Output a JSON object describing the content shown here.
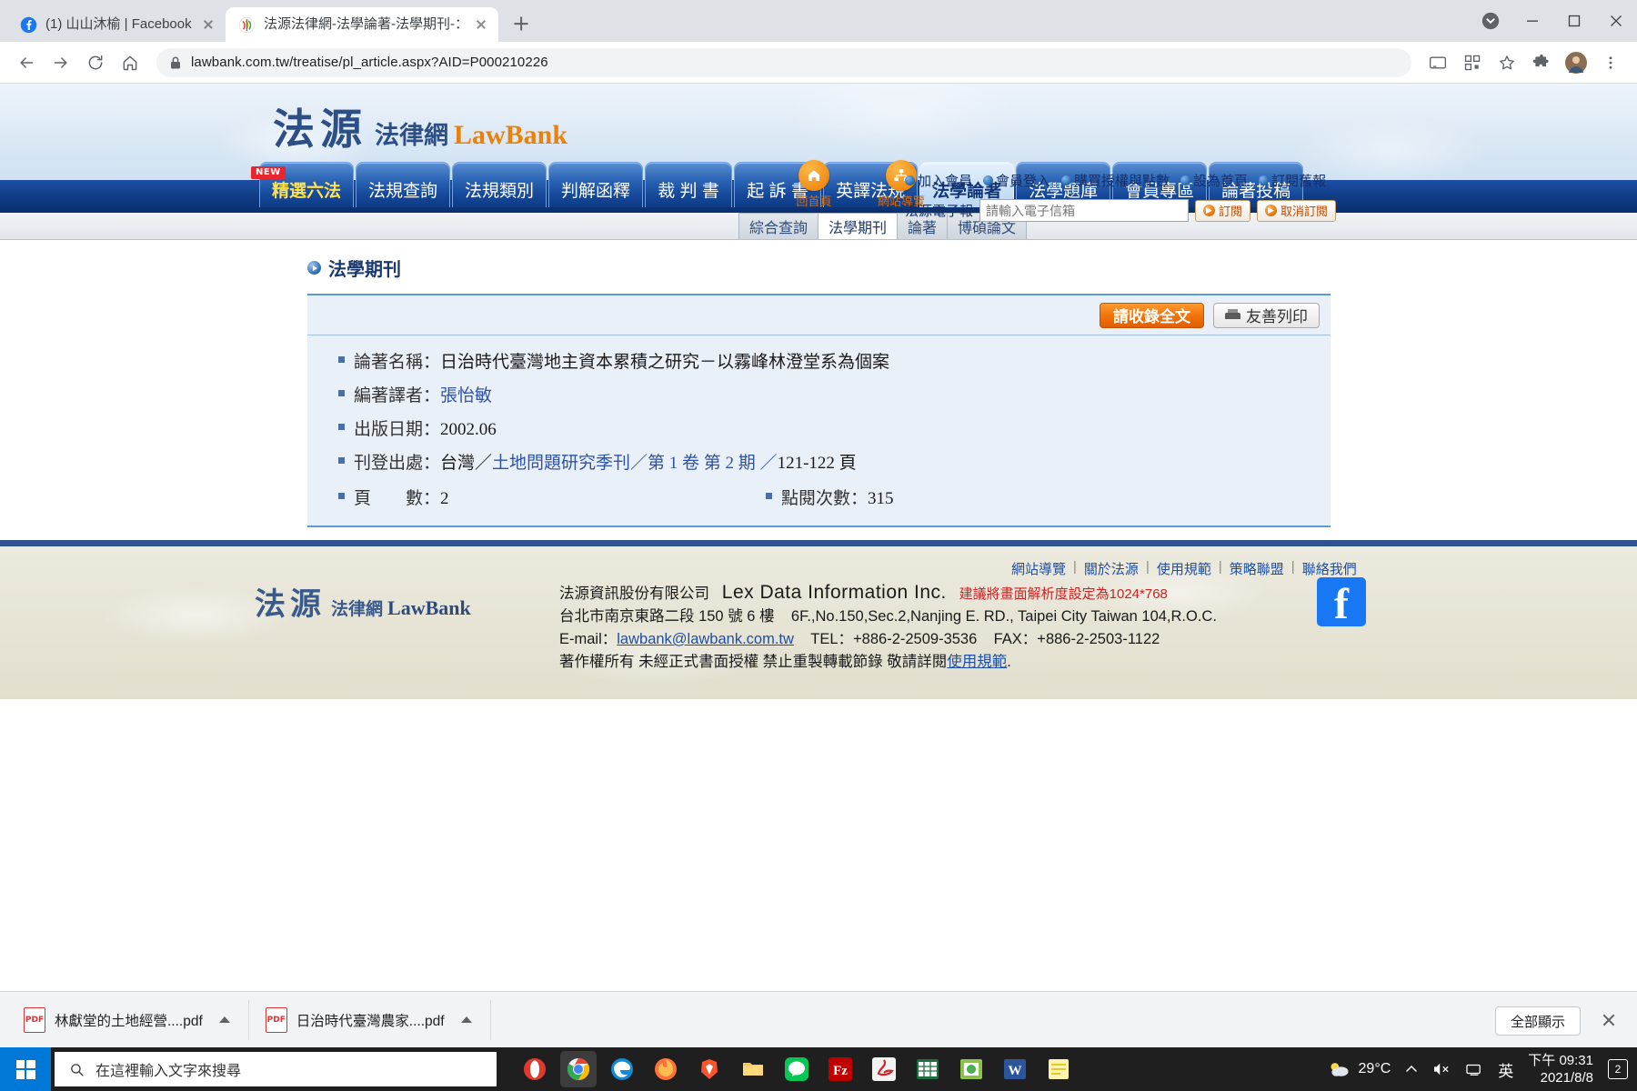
{
  "browser": {
    "tabs": [
      {
        "title": "(1) 山山沐榆 | Facebook",
        "favicon": "facebook-icon",
        "active": false
      },
      {
        "title": "法源法律網-法學論著-法學期刊-：",
        "favicon": "lawbank-icon",
        "active": true
      }
    ],
    "new_tab_label": "+",
    "toolbar": {
      "back": "back-arrow",
      "forward": "forward-arrow",
      "reload": "reload-icon",
      "home": "home-icon",
      "lock": "lock-icon",
      "url": "lawbank.com.tw/treatise/pl_article.aspx?AID=P000210226"
    },
    "window_controls": {
      "minimize": "–",
      "maximize": "□",
      "close": "✕"
    }
  },
  "site": {
    "logo": {
      "cn": "法源",
      "sub": "法律網",
      "en": "LawBank"
    },
    "quick_icons": [
      {
        "icon": "home-icon",
        "label": "回首頁"
      },
      {
        "icon": "sitemap-icon",
        "label": "網站導覽"
      }
    ],
    "top_links": [
      "加入會員",
      "會員登入",
      "購買授權與點數",
      "設為首頁",
      "訂閱舊報"
    ],
    "newsletter": {
      "label": "法源電子報",
      "placeholder": "請輸入電子信箱",
      "value": "",
      "subscribe": "訂閱",
      "unsubscribe": "取消訂閱"
    },
    "nav": [
      {
        "label": "精選六法",
        "badge": "NEW",
        "state": "highlight"
      },
      {
        "label": "法規查詢",
        "state": "normal"
      },
      {
        "label": "法規類別",
        "state": "normal"
      },
      {
        "label": "判解函釋",
        "state": "normal"
      },
      {
        "label": "裁 判 書",
        "state": "normal"
      },
      {
        "label": "起 訴 書",
        "state": "normal"
      },
      {
        "label": "英譯法規",
        "state": "normal"
      },
      {
        "label": "法學論著",
        "state": "active"
      },
      {
        "label": "法學題庫",
        "state": "normal"
      },
      {
        "label": "會員專區",
        "state": "normal"
      },
      {
        "label": "論著投稿",
        "state": "normal"
      }
    ],
    "subnav": [
      {
        "label": "綜合查詢",
        "active": false
      },
      {
        "label": "法學期刊",
        "active": true
      },
      {
        "label": "論著",
        "active": false
      },
      {
        "label": "博碩論文",
        "active": false
      }
    ]
  },
  "main": {
    "page_title": "法學期刊",
    "buttons": {
      "collect_fulltext": "請收錄全文",
      "friendly_print": "友善列印",
      "print_icon": "printer-icon"
    },
    "fields": [
      {
        "label": "論著名稱：",
        "value": "日治時代臺灣地主資本累積之研究－以霧峰林澄堂系為個案",
        "link": false
      },
      {
        "label": "編著譯者：",
        "value": "張怡敏",
        "link": true
      },
      {
        "label": "出版日期：",
        "value": "2002.06",
        "link": false
      }
    ],
    "publication": {
      "label": "刊登出處：",
      "prefix": "台灣／",
      "journal": "土地問題研究季刊",
      "middle": "／第 1 卷 第 2 期 ／",
      "pages": "121-122 頁"
    },
    "pages_row": {
      "label": "頁　　數：",
      "value": "2"
    },
    "views_row": {
      "label": "點閱次數：",
      "value": "315"
    }
  },
  "footer": {
    "logo": {
      "cn": "法源",
      "sub": "法律網",
      "en": "LawBank"
    },
    "links": [
      "網站導覽",
      "關於法源",
      "使用規範",
      "策略聯盟",
      "聯絡我們"
    ],
    "company_cn": "法源資訊股份有限公司",
    "company_en": "Lex Data Information Inc.",
    "notice": "建議將畫面解析度設定為1024*768",
    "address_cn": "台北市南京東路二段 150 號 6 樓",
    "address_en": "6F.,No.150,Sec.2,Nanjing E. RD., Taipei City Taiwan 104,R.O.C.",
    "email_label": "E-mail：",
    "email": "lawbank@lawbank.com.tw",
    "tel": "TEL：+886-2-2509-3536",
    "fax": "FAX：+886-2-2503-1122",
    "copyright_pre": "著作權所有 未經正式書面授權 禁止重製轉載節錄 敬請詳閱",
    "copyright_link": "使用規範",
    "copyright_post": ".",
    "facebook_icon": "facebook-icon"
  },
  "downloads": {
    "items": [
      {
        "name": "林獻堂的土地經營....pdf",
        "icon": "pdf-icon",
        "menu": "chevron-up-icon"
      },
      {
        "name": "日治時代臺灣農家....pdf",
        "icon": "pdf-icon",
        "menu": "chevron-up-icon"
      }
    ],
    "show_all": "全部顯示",
    "close": "close-icon"
  },
  "taskbar": {
    "start": "windows-start-icon",
    "search_placeholder": "在這裡輸入文字來搜尋",
    "search_icon": "search-icon",
    "apps": [
      "opera-icon",
      "chrome-icon",
      "edge-icon",
      "firefox-icon",
      "brave-icon",
      "file-explorer-icon",
      "line-icon",
      "filezilla-icon",
      "acrobat-icon",
      "excel-icon",
      "powerpoint-icon",
      "word-icon",
      "sticky-notes-icon"
    ],
    "weather": {
      "icon": "partly-cloudy-icon",
      "temp": "29°C"
    },
    "tray": [
      "chevron-up-icon",
      "volume-mute-icon",
      "network-icon",
      "ime-icon"
    ],
    "clock": {
      "time": "下午 09:31",
      "date": "2021/8/8"
    },
    "notification_badge": "2"
  },
  "colors": {
    "brand_blue": "#2b4f86",
    "brand_orange": "#e8820c",
    "nav_blue": "#0f3c86",
    "accent_line": "#5a9bd5",
    "card_bg": "#eaf0f8",
    "link": "#2d52a8"
  }
}
